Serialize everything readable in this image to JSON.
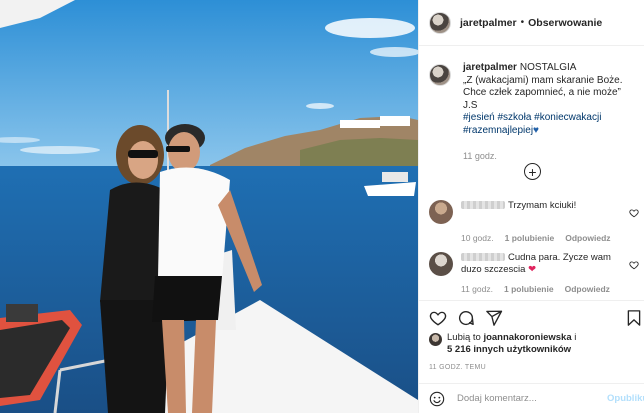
{
  "post": {
    "username": "jaretpalmer",
    "follow_label": "Obserwowanie",
    "caption": {
      "username": "jaretpalmer",
      "title": "NOSTALGIA",
      "line1": "„Z (wakacjami) mam skaranie Boże.",
      "line2": "Chce człek zapomnieć, a nie może” J.S",
      "tags": [
        "#jesień",
        "#szkoła",
        "#koniecwakacji",
        "#razemnajlepiej"
      ],
      "time": "11 godz."
    },
    "comments": [
      {
        "text": "Trzymam kciuki!",
        "time": "10 godz.",
        "likes": "1 polubienie",
        "reply": "Odpowiedz"
      },
      {
        "text": "Cudna para. Zycze wam duzo szczescia",
        "time": "11 godz.",
        "likes": "1 polubienie",
        "reply": "Odpowiedz"
      }
    ],
    "likes": {
      "prefix": "Lubią to",
      "user": "joannakoroniewska",
      "connector": "i",
      "others": "5 216 innych użytkowników"
    },
    "timestamp": "11 GODZ. TEMU",
    "composer": {
      "placeholder": "Dodaj komentarz...",
      "publish_label": "Opublikuj"
    }
  },
  "icons": {
    "more": "plus-circle-icon",
    "like": "heart-icon",
    "comment": "comment-icon",
    "share": "share-icon",
    "save": "bookmark-icon",
    "emoji": "emoji-icon"
  },
  "colors": {
    "link": "#00376b",
    "muted": "#8e8e8e",
    "publish_disabled": "#b2dffc",
    "heart": "#e0245e"
  }
}
